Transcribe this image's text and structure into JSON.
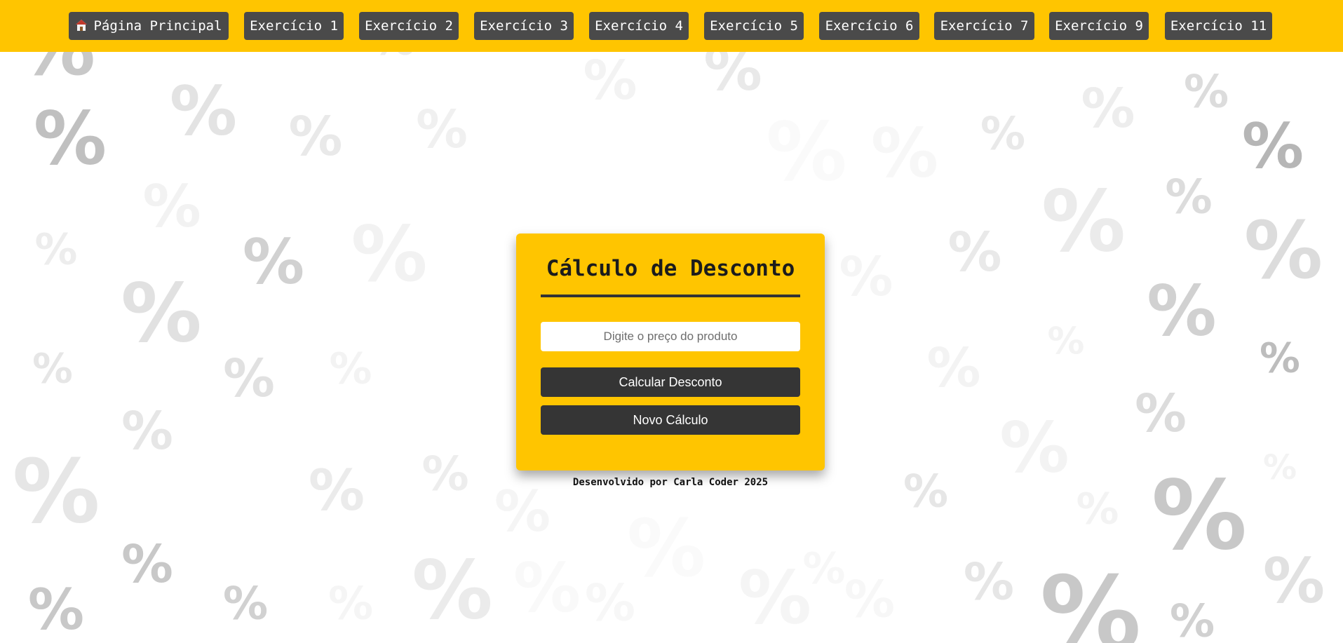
{
  "background": {
    "symbol": "%",
    "color": "#9a9a9a"
  },
  "nav": {
    "items": [
      {
        "name": "nav-home-button",
        "label": "Página Principal",
        "icon": "home-icon"
      },
      {
        "name": "nav-exercicio-1-button",
        "label": "Exercício 1"
      },
      {
        "name": "nav-exercicio-2-button",
        "label": "Exercício 2"
      },
      {
        "name": "nav-exercicio-3-button",
        "label": "Exercício 3"
      },
      {
        "name": "nav-exercicio-4-button",
        "label": "Exercício 4"
      },
      {
        "name": "nav-exercicio-5-button",
        "label": "Exercício 5"
      },
      {
        "name": "nav-exercicio-6-button",
        "label": "Exercício 6"
      },
      {
        "name": "nav-exercicio-7-button",
        "label": "Exercício 7"
      },
      {
        "name": "nav-exercicio-9-button",
        "label": "Exercício 9"
      },
      {
        "name": "nav-exercicio-11-button",
        "label": "Exercício 11"
      }
    ],
    "accent": "#ffc500",
    "button_color": "#4a4a4a"
  },
  "card": {
    "title": "Cálculo de Desconto",
    "price_input": {
      "value": "",
      "placeholder": "Digite o preço do produto"
    },
    "calculate_label": "Calcular Desconto",
    "new_label": "Novo Cálculo"
  },
  "footer": {
    "text": "Desenvolvido por Carla Coder 2025"
  }
}
